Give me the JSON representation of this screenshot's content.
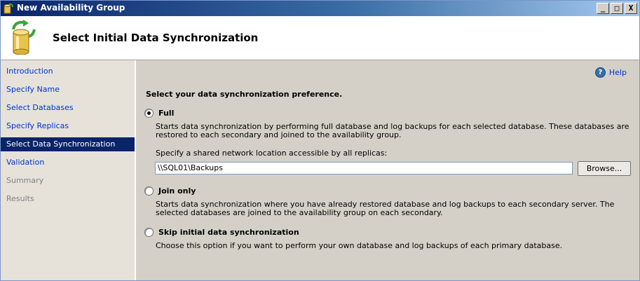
{
  "window": {
    "title": "New Availability Group",
    "controls": {
      "minimize": "_",
      "maximize": "□",
      "close": "X"
    }
  },
  "header": {
    "title": "Select Initial Data Synchronization"
  },
  "sidebar": {
    "items": [
      {
        "label": "Introduction",
        "state": "link"
      },
      {
        "label": "Specify Name",
        "state": "link"
      },
      {
        "label": "Select Databases",
        "state": "link"
      },
      {
        "label": "Specify Replicas",
        "state": "link"
      },
      {
        "label": "Select Data Synchronization",
        "state": "selected"
      },
      {
        "label": "Validation",
        "state": "link"
      },
      {
        "label": "Summary",
        "state": "disabled"
      },
      {
        "label": "Results",
        "state": "disabled"
      }
    ]
  },
  "main": {
    "help_label": "Help",
    "prompt": "Select your data synchronization preference.",
    "options": [
      {
        "label": "Full",
        "checked": true,
        "description": "Starts data synchronization by performing full database and log backups for each selected database. These databases are restored to each secondary and joined to the availability group."
      },
      {
        "label": "Join only",
        "checked": false,
        "description": "Starts data synchronization where you have already restored database and log backups to each secondary server. The selected databases are joined to the availability group on each secondary."
      },
      {
        "label": "Skip initial data synchronization",
        "checked": false,
        "description": "Choose this option if you want to perform your own database and log backups of each primary database."
      }
    ],
    "share_label": "Specify a shared network location accessible by all replicas:",
    "share_value": "\\\\SQL01\\Backups",
    "browse_label": "Browse..."
  },
  "colors": {
    "selected_nav": "#0a246a",
    "link": "#0033cc",
    "title_bar": "#0a246a"
  }
}
